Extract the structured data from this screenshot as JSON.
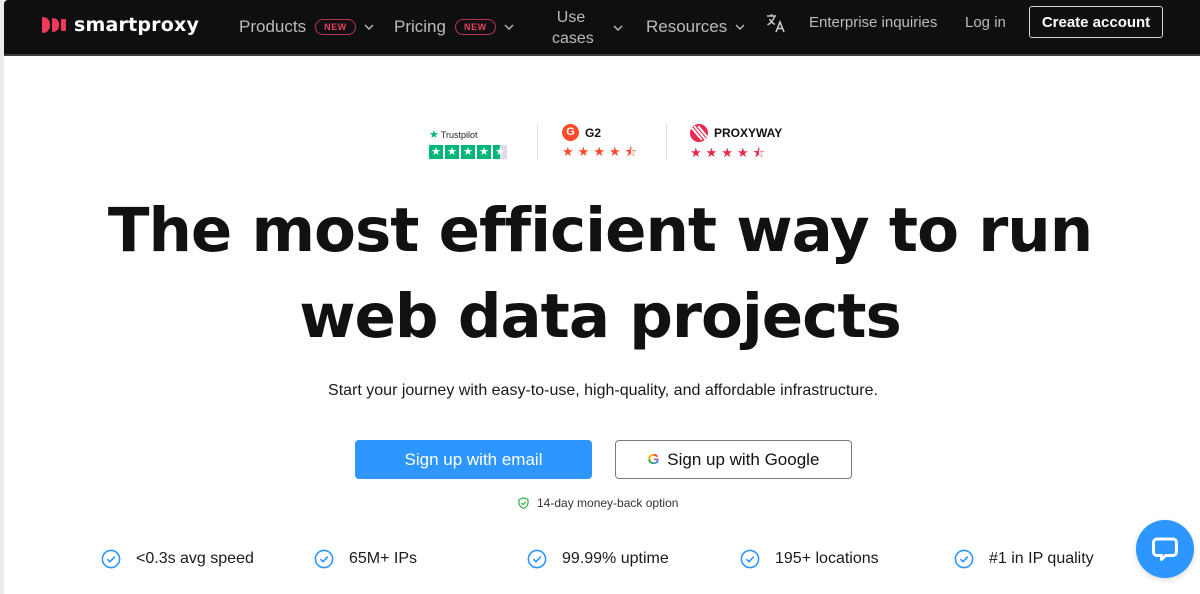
{
  "header": {
    "brand": "smartproxy",
    "nav": [
      {
        "label": "Products",
        "badge": "NEW",
        "icon": "chevron-down-icon"
      },
      {
        "label": "Pricing",
        "badge": "NEW",
        "icon": "chevron-down-icon"
      },
      {
        "label": "Use cases",
        "icon": "chevron-down-icon"
      },
      {
        "label": "Resources",
        "icon": "chevron-down-icon"
      }
    ],
    "language_icon": "translate-icon",
    "enterprise": "Enterprise inquiries",
    "login": "Log in",
    "create_account": "Create account"
  },
  "ratings": {
    "trustpilot": {
      "name": "Trustpilot",
      "stars": 4.5,
      "accent": "#00b67a"
    },
    "g2": {
      "name": "G2",
      "stars": 4.5,
      "accent": "#ff492c"
    },
    "proxyway": {
      "name": "PROXYWAY",
      "stars": 4.5,
      "accent": "#e8284d"
    }
  },
  "hero": {
    "headline_line1": "The most efficient way to run",
    "headline_line2": "web data projects",
    "subtitle": "Start your journey with easy-to-use, high-quality, and affordable infrastructure.",
    "cta_email": "Sign up with email",
    "cta_google": "Sign up with Google",
    "moneyback": "14-day money-back option"
  },
  "features": [
    "<0.3s avg speed",
    "65M+ IPs",
    "99.99% uptime",
    "195+ locations",
    "#1 in IP quality"
  ],
  "colors": {
    "header_bg": "#0e0f11",
    "brand_red": "#f0385a",
    "primary_blue": "#2d96ff",
    "badge_red": "#e8415f"
  },
  "chat": {
    "icon": "chat-bubble-icon"
  }
}
